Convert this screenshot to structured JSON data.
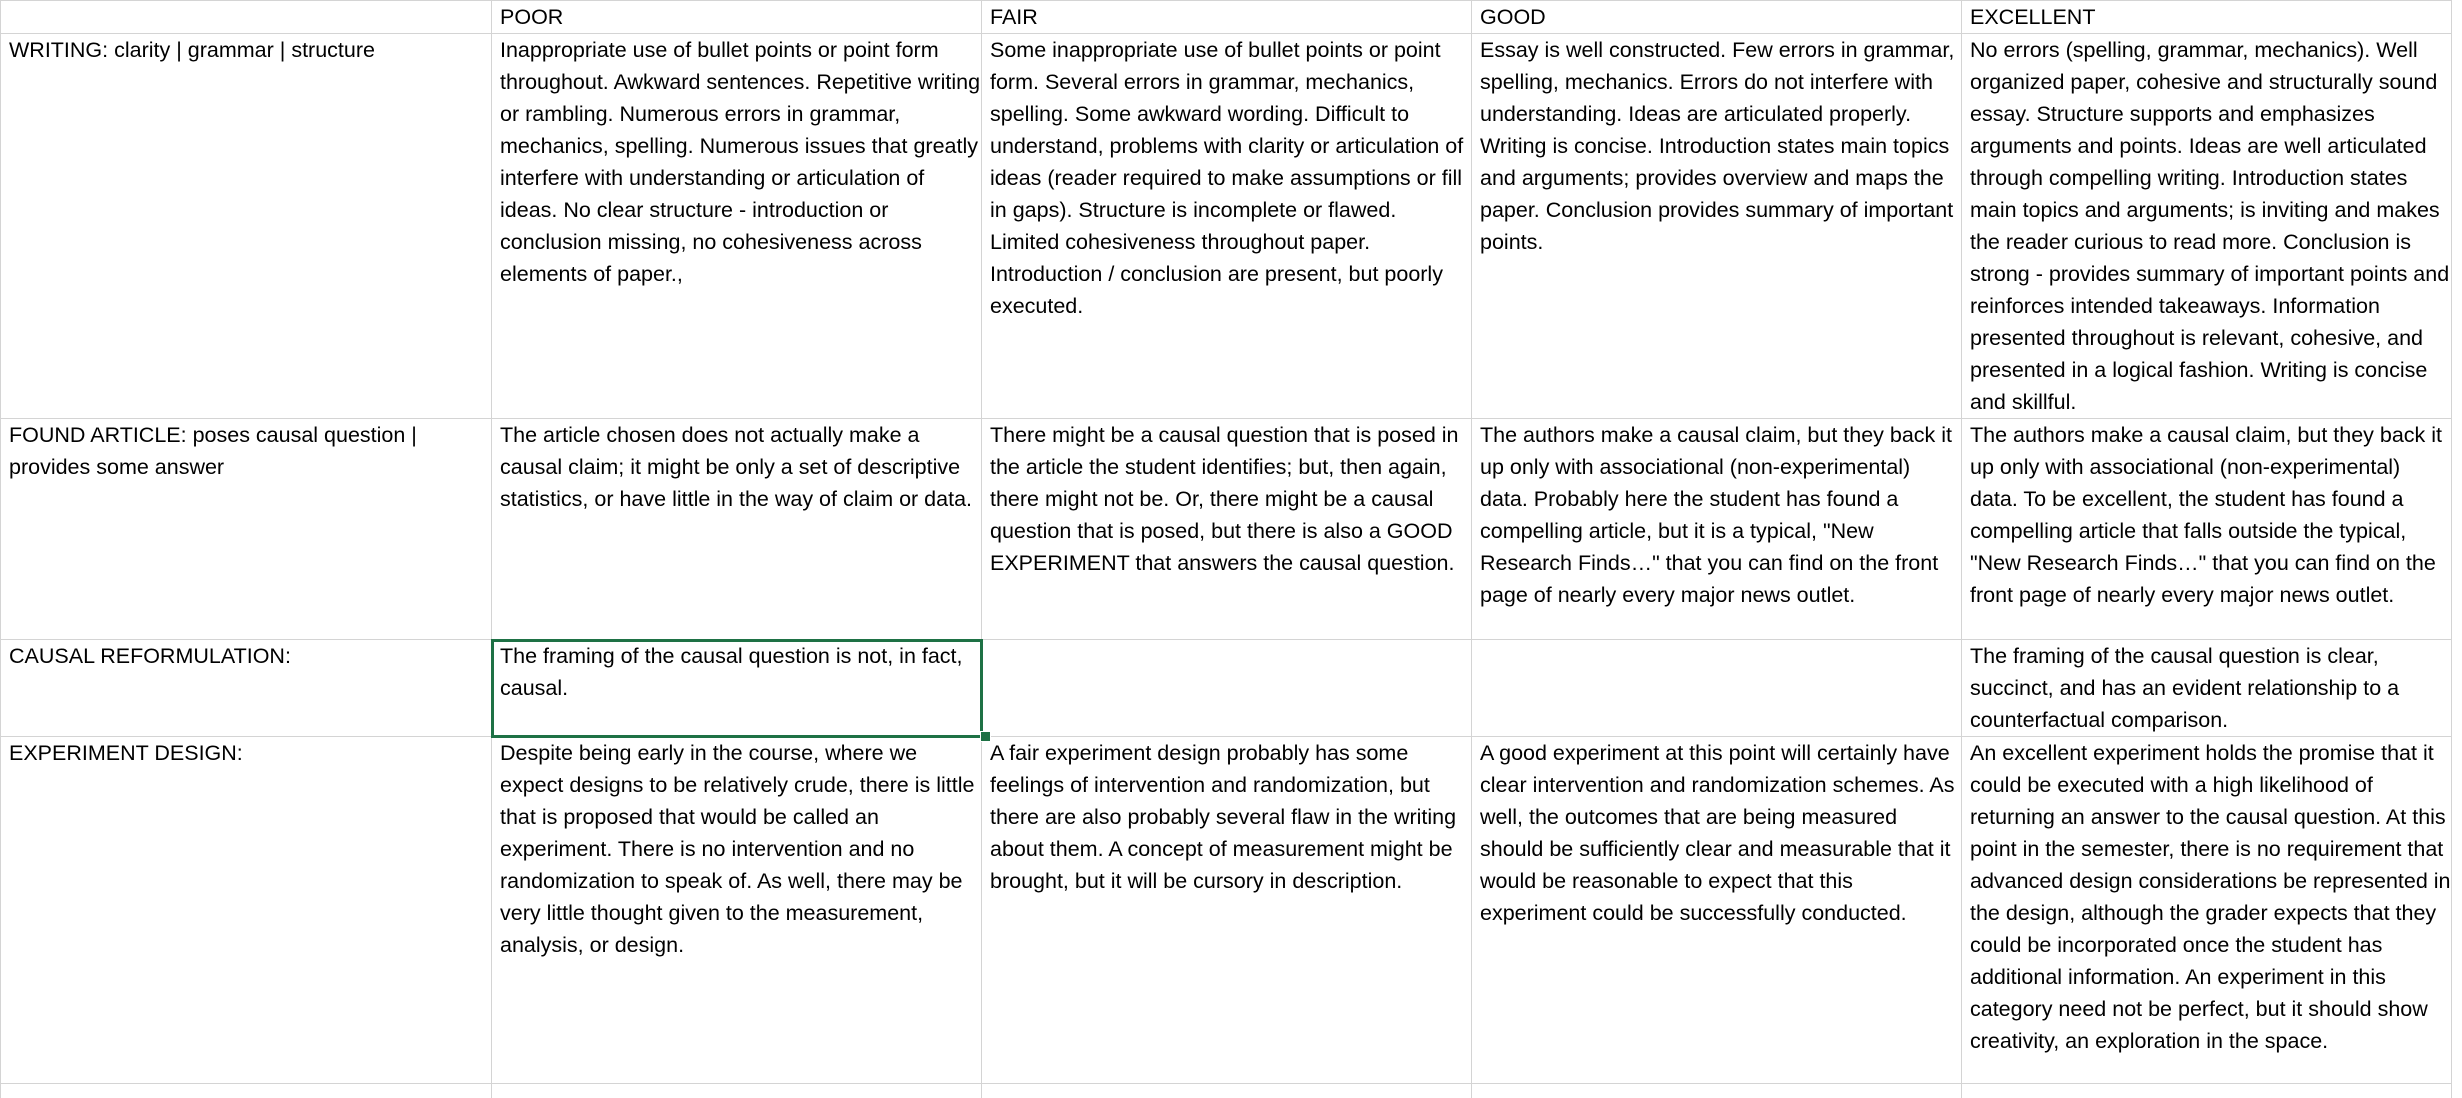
{
  "sheet": {
    "headers": {
      "a": "",
      "b": "POOR",
      "c": "FAIR",
      "d": "GOOD",
      "e": "EXCELLENT"
    },
    "rows": [
      {
        "criterion": "WRITING: clarity | grammar | structure",
        "poor": "Inappropriate use of bullet points or point form throughout. Awkward sentences. Repetitive writing or rambling. Numerous errors in grammar, mechanics, spelling. Numerous issues that greatly interfere with understanding or articulation of ideas. No clear structure - introduction or conclusion missing, no cohesiveness across elements of paper.,",
        "fair": "Some inappropriate use of bullet points or point form. Several errors in grammar, mechanics, spelling. Some awkward wording. Difficult to understand, problems with clarity or articulation of ideas (reader required to make assumptions or fill in gaps). Structure is incomplete or flawed. Limited cohesiveness throughout paper. Introduction / conclusion are present, but poorly executed.",
        "good": "Essay is well constructed. Few errors in grammar, spelling, mechanics. Errors do not interfere with understanding. Ideas are articulated properly. Writing is concise. Introduction states main topics and arguments; provides overview and maps the paper. Conclusion provides summary of important points.",
        "excellent": "No errors (spelling, grammar, mechanics). Well organized paper, cohesive and structurally sound essay. Structure supports and emphasizes arguments and points. Ideas are well articulated through compelling writing. Introduction states main topics and arguments; is inviting and makes the reader curious to read more. Conclusion is strong - provides summary of important points and reinforces intended takeaways. Information presented throughout is relevant, cohesive, and presented in a logical fashion. Writing is concise and skillful."
      },
      {
        "criterion": "FOUND ARTICLE: poses causal question | provides some answer",
        "poor": "The article chosen does not actually make a causal claim; it might be only a set of descriptive statistics, or have little in the way of claim or data.",
        "fair": "There might be a causal question that is posed in the article the student identifies; but, then again, there might not be. Or, there might be a causal question that is posed, but there is also a GOOD EXPERIMENT that answers the causal question.",
        "good": "The authors make a causal claim, but they back it up only with associational (non-experimental) data. Probably here the student has found a compelling article, but it is a typical, \"New Research Finds…\"  that you can find on the front page of nearly every major news outlet.",
        "excellent": "The authors make a causal claim, but they back it up only with associational (non-experimental) data. To be excellent, the student has found a compelling article that falls outside the typical, \"New Research Finds…\"  that you can find on the front page of nearly every major news outlet."
      },
      {
        "criterion": "CAUSAL REFORMULATION:",
        "poor": "The framing of the causal question is not, in fact, causal.",
        "fair": "",
        "good": "",
        "excellent": "The framing of the causal question is clear, succinct, and has an evident relationship to a counterfactual comparison."
      },
      {
        "criterion": "EXPERIMENT DESIGN:",
        "poor": "Despite being early in the course, where we expect designs to be relatively crude, there is little that is proposed that would be called an experiment. There is no intervention and no randomization to speak of. As well, there may be very little thought given to the measurement, analysis, or design.",
        "fair": "A fair experiment design probably has some feelings of intervention and randomization, but there are also probably several flaw in the writing about them. A concept of measurement might be brought, but it will be cursory in description.",
        "good": "A good experiment at this point will certainly have clear intervention and randomization schemes. As well, the outcomes that are being measured should be sufficiently clear and measurable that it would be reasonable to expect that this experiment could be successfully conducted.",
        "excellent": "An excellent experiment holds the promise that it could be executed with a high likelihood of returning an answer to the causal question. At this point in the semester, there is no requirement that advanced design considerations be represented in the design, although the grader expects that they could be incorporated once the student has additional information. An experiment in this category need not be perfect, but it should show creativity, an exploration in the space."
      }
    ]
  },
  "colors": {
    "gridline": "#d4d4d4",
    "selection": "#1e7145"
  }
}
